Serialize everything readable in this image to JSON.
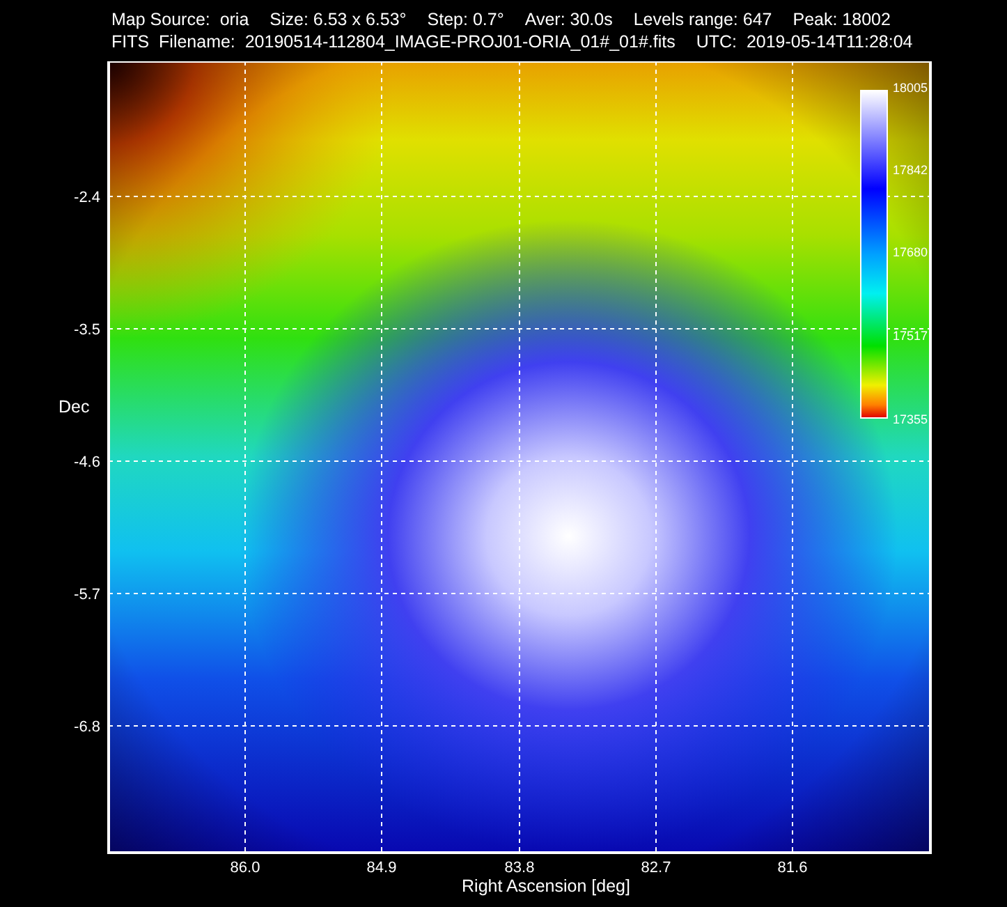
{
  "header": {
    "line_1": [
      "Map Source:  oria",
      "Size: 6.53 x 6.53°",
      "Step: 0.7°",
      "Aver: 30.0s",
      "Levels range: 647",
      "Peak: 18002"
    ],
    "line_2": [
      "FITS  Filename:  20190514-112804_IMAGE-PROJ01-ORIA_01#_01#.fits",
      "UTC:  2019-05-14T11:28:04"
    ]
  },
  "plot": {
    "xlabel": "Right Ascension [deg]",
    "ylabel": "Dec",
    "xticks": [
      "86.0",
      "84.9",
      "83.8",
      "82.7",
      "81.6"
    ],
    "yticks": [
      "-2.4",
      "-3.5",
      "-4.6",
      "-5.7",
      "-6.8"
    ],
    "colorbar_ticks": [
      "18005",
      "17842",
      "17680",
      "17517",
      "17355"
    ]
  }
}
